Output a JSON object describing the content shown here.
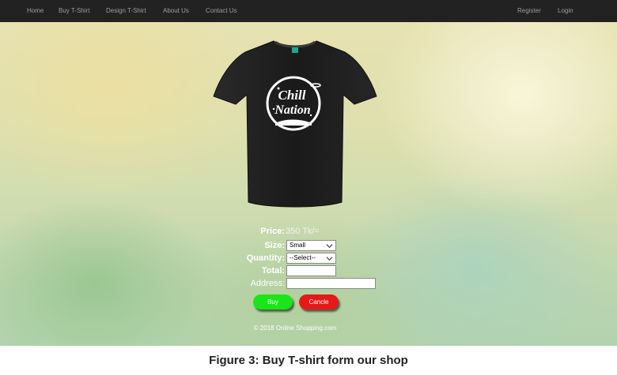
{
  "nav": {
    "left_items": [
      "Home",
      "Buy T-Shirt",
      "Design T-Shirt",
      "About Us",
      "Contact Us"
    ],
    "right_items": [
      "Register",
      "Login"
    ]
  },
  "product": {
    "image_text_line1": "Chill",
    "image_text_line2": "Nation",
    "shirt_color": "#1e1e1e"
  },
  "form": {
    "price_label": "Price:",
    "price_value": "350 Tk/=",
    "size_label": "Size:",
    "size_selected": "Small",
    "quantity_label": "Quantity:",
    "quantity_selected": "--Select--",
    "total_label": "Total:",
    "total_value": "",
    "address_label": "Address:",
    "address_value": ""
  },
  "buttons": {
    "buy": "Buy",
    "cancel": "Cancle",
    "buy_color": "#19e619",
    "cancel_color": "#e61919"
  },
  "footer": {
    "copyright": "© 2018 Online Shopping.com"
  },
  "caption": "Figure 3: Buy T-shirt form our shop"
}
